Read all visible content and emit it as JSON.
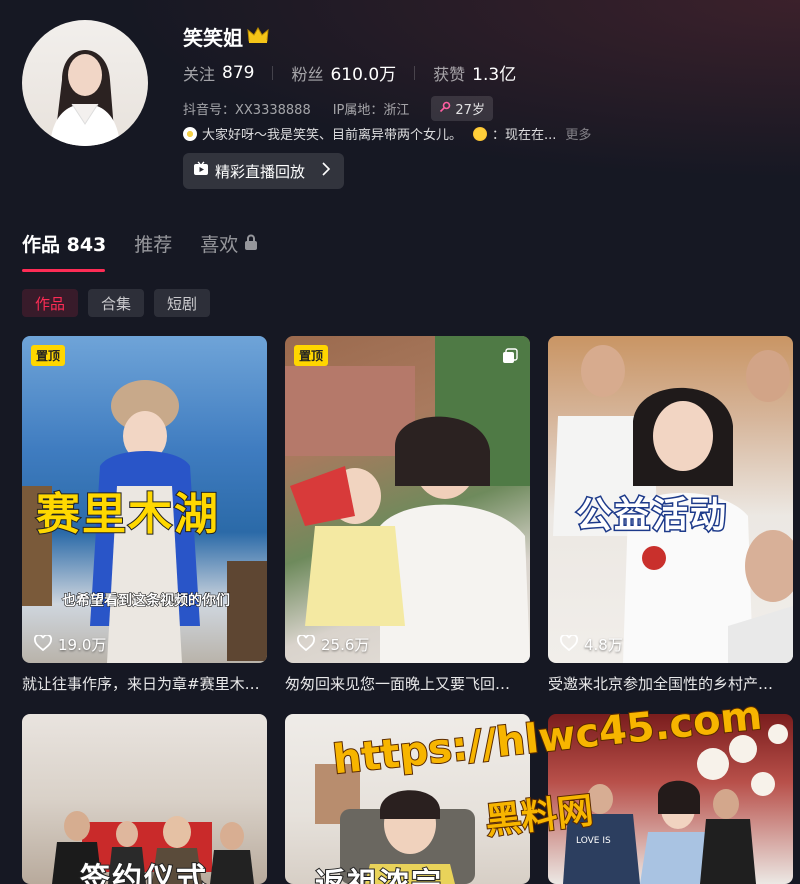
{
  "profile": {
    "nickname": "笑笑姐",
    "crown_icon": "crown-icon",
    "stats": [
      {
        "label": "关注",
        "value": "879"
      },
      {
        "label": "粉丝",
        "value": "610.0万"
      },
      {
        "label": "获赞",
        "value": "1.3亿"
      }
    ],
    "douyin_id": "抖音号：XX3338888",
    "ip_location": "IP属地：浙江",
    "age": "27岁",
    "bio": "大家好呀～我是笑笑、目前离异带两个女儿。",
    "bio_tail": "：现在在...",
    "bio_more": "更多",
    "live_replay_label": "精彩直播回放"
  },
  "tabs": [
    {
      "label": "作品 843",
      "active": true
    },
    {
      "label": "推荐",
      "active": false
    },
    {
      "label": "喜欢",
      "active": false,
      "locked": true
    }
  ],
  "chips": [
    {
      "label": "作品",
      "active": true
    },
    {
      "label": "合集",
      "active": false
    },
    {
      "label": "短剧",
      "active": false
    }
  ],
  "videos": [
    {
      "pinned": "置顶",
      "overlay_title": "赛里木湖",
      "overlay_sub": "也希望看到这条视频的你们",
      "likes": "19.0万",
      "caption": "就让往事作序，来日为章#赛里木…"
    },
    {
      "pinned": "置顶",
      "likes": "25.6万",
      "caption": "匆匆回来见您一面晚上又要飞回…"
    },
    {
      "overlay_title": "公益活动",
      "likes": "4.8万",
      "caption": "受邀来北京参加全国性的乡村产…"
    },
    {
      "overlay_title": "签约仪式"
    },
    {
      "overlay_title": "返祖浓宗"
    },
    {
      "shirt_text": "LOVE IS"
    }
  ],
  "watermark": {
    "line1": "https://hlwc45.com",
    "line2": "黑料网"
  },
  "colors": {
    "background": "#161823",
    "accent": "#fe2c55",
    "pin": "#ffd600",
    "watermark": "#f7b500"
  }
}
